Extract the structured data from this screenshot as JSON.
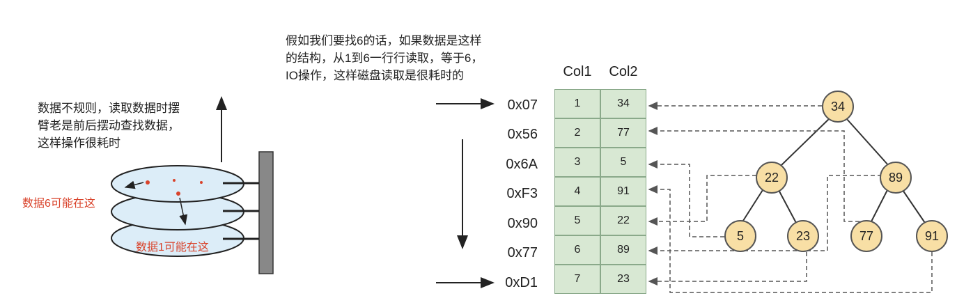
{
  "left": {
    "note": [
      "数据不规则，读取数据时摆",
      "臂老是前后摆动查找数据，",
      "这样操作很耗时"
    ],
    "label_data6": "数据6可能在这",
    "label_data1": "数据1可能在这"
  },
  "top_note": [
    "假如我们要找6的话，如果数据是这样",
    "的结构，从1到6一行行读取，等于6，",
    "IO操作，这样磁盘读取是很耗时的"
  ],
  "table": {
    "headers": [
      "Col1",
      "Col2"
    ],
    "rows": [
      {
        "addr": "0x07",
        "col1": "1",
        "col2": "34"
      },
      {
        "addr": "0x56",
        "col1": "2",
        "col2": "77"
      },
      {
        "addr": "0x6A",
        "col1": "3",
        "col2": "5"
      },
      {
        "addr": "0xF3",
        "col1": "4",
        "col2": "91"
      },
      {
        "addr": "0x90",
        "col1": "5",
        "col2": "22"
      },
      {
        "addr": "0x77",
        "col1": "6",
        "col2": "89"
      },
      {
        "addr": "0xD1",
        "col1": "7",
        "col2": "23"
      }
    ]
  },
  "tree": {
    "root": "34",
    "level2": [
      "22",
      "89"
    ],
    "leaves": [
      "5",
      "23",
      "77",
      "91"
    ]
  },
  "colors": {
    "cell_fill": "#d8e8d3",
    "node_fill": "#f8dfa5",
    "disk_fill": "#dcedf8",
    "annotation_red": "#d9432b"
  }
}
